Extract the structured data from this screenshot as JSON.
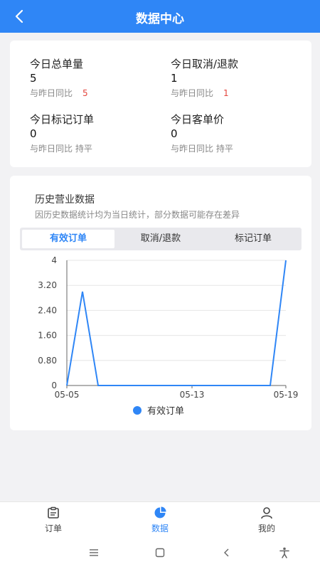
{
  "header": {
    "title": "数据中心",
    "back_icon": "chevron-left-icon"
  },
  "stats": [
    {
      "label": "今日总单量",
      "value": "5",
      "compare_label": "与昨日同比",
      "compare_value": "5"
    },
    {
      "label": "今日取消/退款",
      "value": "1",
      "compare_label": "与昨日同比",
      "compare_value": "1"
    },
    {
      "label": "今日标记订单",
      "value": "0",
      "compare_label": "与昨日同比 持平",
      "compare_value": ""
    },
    {
      "label": "今日客单价",
      "value": "0",
      "compare_label": "与昨日同比 持平",
      "compare_value": ""
    }
  ],
  "history": {
    "title": "历史营业数据",
    "note": "因历史数据统计均为当日统计，部分数据可能存在差异",
    "tabs": [
      {
        "label": "有效订单",
        "active": true
      },
      {
        "label": "取消/退款",
        "active": false
      },
      {
        "label": "标记订单",
        "active": false
      }
    ]
  },
  "chart_data": {
    "type": "line",
    "x": [
      "05-05",
      "05-06",
      "05-07",
      "05-08",
      "05-09",
      "05-10",
      "05-11",
      "05-12",
      "05-13",
      "05-14",
      "05-15",
      "05-16",
      "05-17",
      "05-18",
      "05-19"
    ],
    "x_tick_labels": [
      "05-05",
      "05-13",
      "05-19"
    ],
    "series": [
      {
        "name": "有效订单",
        "values": [
          0,
          3,
          0,
          0,
          0,
          0,
          0,
          0,
          0,
          0,
          0,
          0,
          0,
          0,
          4
        ],
        "color": "#2f86f6"
      }
    ],
    "y_ticks": [
      "0",
      "0.80",
      "1.60",
      "2.40",
      "3.20",
      "4"
    ],
    "ylim": [
      0,
      4
    ],
    "grid": true,
    "legend": "bottom"
  },
  "tabbar": [
    {
      "label": "订单",
      "icon": "clipboard-icon",
      "active": false
    },
    {
      "label": "数据",
      "icon": "pie-chart-icon",
      "active": true
    },
    {
      "label": "我的",
      "icon": "user-icon",
      "active": false
    }
  ],
  "system_nav": [
    "menu-icon",
    "home-icon",
    "back-icon",
    "accessibility-icon"
  ]
}
